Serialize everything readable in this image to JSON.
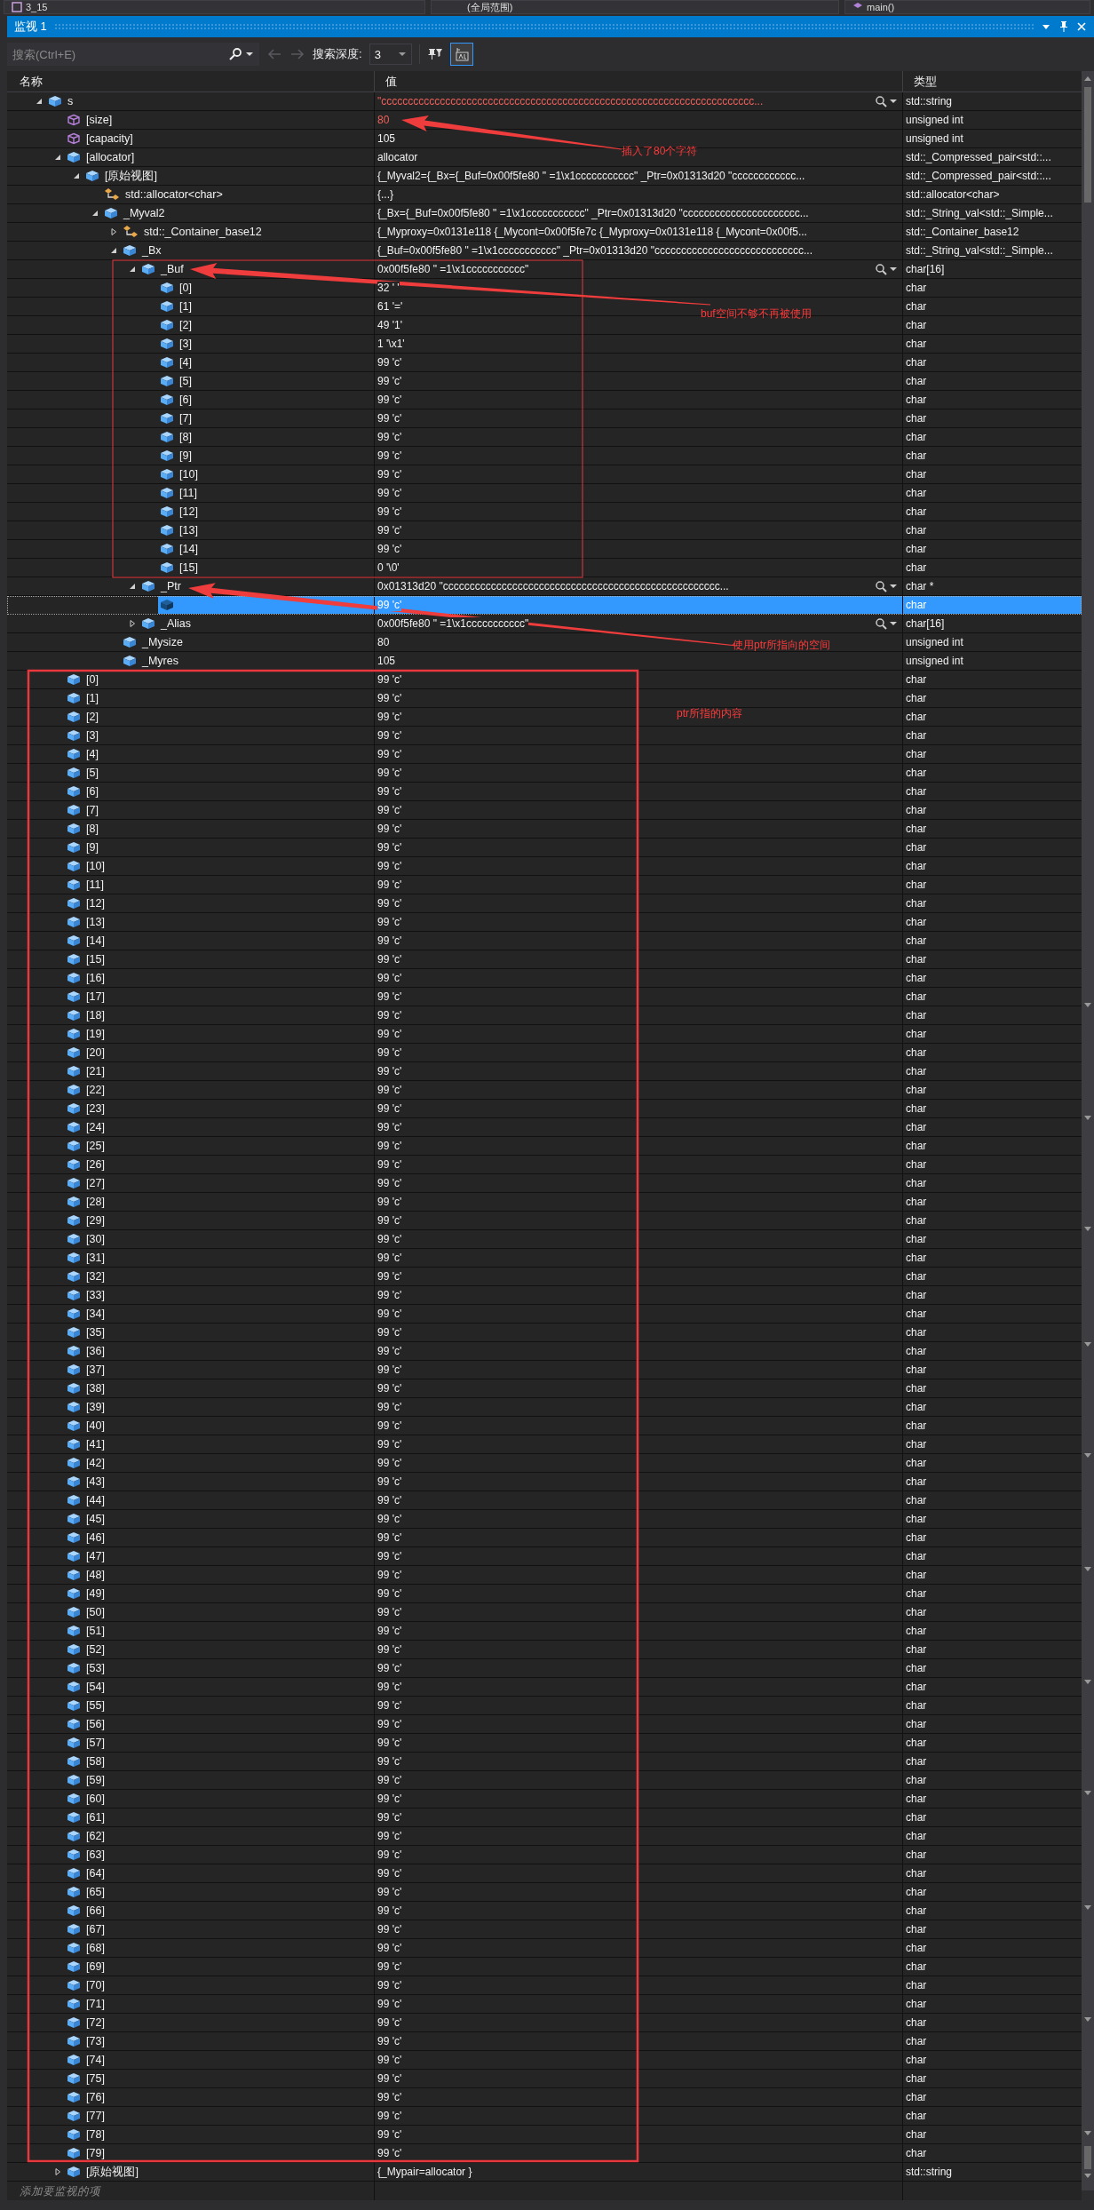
{
  "top_bar": {
    "project": "3_15",
    "scope": "(全局范围)",
    "function": "main()"
  },
  "window": {
    "title": "监视 1"
  },
  "search": {
    "placeholder": "搜索(Ctrl+E)",
    "history_disabled": true,
    "depth_label": "搜索深度:",
    "depth": "3",
    "view_toggle_selected": true
  },
  "columns": [
    "名称",
    "值",
    "类型"
  ],
  "rows": [
    {
      "name": "s",
      "value": "\"cccccccccccccccccccccccccccccccccccccccccccccccccccccccccccccccccccccc...",
      "type": "std::string",
      "kind": "field",
      "expanded": true,
      "changed": true,
      "visualizer": true,
      "selected": false,
      "children": [
        {
          "name": "[size]",
          "value": "80",
          "type": "unsigned int",
          "kind": "property",
          "changed": true,
          "selected": false
        },
        {
          "name": "[capacity]",
          "value": "105",
          "type": "unsigned int",
          "kind": "property",
          "changed": false,
          "selected": false
        },
        {
          "name": "[allocator]",
          "value": "allocator",
          "type": "std::_Compressed_pair<std::...",
          "kind": "field",
          "expanded": true,
          "changed": false,
          "selected": false,
          "children": [
            {
              "name": "[原始视图]",
              "value": "{_Myval2={_Bx={_Buf=0x00f5fe80 \" =1\\x1ccccccccccc\" _Ptr=0x01313d20 \"cccccccccccc...",
              "type": "std::_Compressed_pair<std::...",
              "kind": "field",
              "expanded": true,
              "changed": false,
              "selected": false,
              "children": [
                {
                  "name": "std::allocator<char>",
                  "value": "{...}",
                  "type": "std::allocator<char>",
                  "kind": "base",
                  "changed": false,
                  "selected": false
                },
                {
                  "name": "_Myval2",
                  "value": "{_Bx={_Buf=0x00f5fe80 \" =1\\x1ccccccccccc\" _Ptr=0x01313d20 \"cccccccccccccccccccccc...",
                  "type": "std::_String_val<std::_Simple...",
                  "kind": "field",
                  "expanded": true,
                  "changed": false,
                  "selected": false,
                  "children": [
                    {
                      "name": "std::_Container_base12",
                      "value": "{_Myproxy=0x0131e118 {_Mycont=0x00f5fe7c {_Myproxy=0x0131e118 {_Mycont=0x00f5...",
                      "type": "std::_Container_base12",
                      "kind": "base",
                      "expanded": false,
                      "changed": false,
                      "selected": false
                    },
                    {
                      "name": "_Bx",
                      "value": "{_Buf=0x00f5fe80 \" =1\\x1ccccccccccc\" _Ptr=0x01313d20 \"cccccccccccccccccccccccccccc...",
                      "type": "std::_String_val<std::_Simple...",
                      "kind": "field",
                      "expanded": true,
                      "changed": false,
                      "selected": false,
                      "children": [
                        {
                          "name": "_Buf",
                          "value": "0x00f5fe80 \" =1\\x1ccccccccccc\"",
                          "type": "char[16]",
                          "kind": "field",
                          "expanded": true,
                          "changed": false,
                          "visualizer": true,
                          "selected": false,
                          "children": [
                            {
                              "name": "[0]",
                              "value": "32 ' '",
                              "type": "char",
                              "kind": "field",
                              "changed": false,
                              "selected": false
                            },
                            {
                              "name": "[1]",
                              "value": "61 '='",
                              "type": "char",
                              "kind": "field",
                              "changed": false,
                              "selected": false
                            },
                            {
                              "name": "[2]",
                              "value": "49 '1'",
                              "type": "char",
                              "kind": "field",
                              "changed": false,
                              "selected": false
                            },
                            {
                              "name": "[3]",
                              "value": "1 '\\x1'",
                              "type": "char",
                              "kind": "field",
                              "changed": false,
                              "selected": false
                            },
                            {
                              "name": "[4]",
                              "value": "99 'c'",
                              "type": "char",
                              "kind": "field",
                              "changed": false,
                              "selected": false
                            },
                            {
                              "name": "[5]",
                              "value": "99 'c'",
                              "type": "char",
                              "kind": "field",
                              "changed": false,
                              "selected": false
                            },
                            {
                              "name": "[6]",
                              "value": "99 'c'",
                              "type": "char",
                              "kind": "field",
                              "changed": false,
                              "selected": false
                            },
                            {
                              "name": "[7]",
                              "value": "99 'c'",
                              "type": "char",
                              "kind": "field",
                              "changed": false,
                              "selected": false
                            },
                            {
                              "name": "[8]",
                              "value": "99 'c'",
                              "type": "char",
                              "kind": "field",
                              "changed": false,
                              "selected": false
                            },
                            {
                              "name": "[9]",
                              "value": "99 'c'",
                              "type": "char",
                              "kind": "field",
                              "changed": false,
                              "selected": false
                            },
                            {
                              "name": "[10]",
                              "value": "99 'c'",
                              "type": "char",
                              "kind": "field",
                              "changed": false,
                              "selected": false
                            },
                            {
                              "name": "[11]",
                              "value": "99 'c'",
                              "type": "char",
                              "kind": "field",
                              "changed": false,
                              "selected": false
                            },
                            {
                              "name": "[12]",
                              "value": "99 'c'",
                              "type": "char",
                              "kind": "field",
                              "changed": false,
                              "selected": false
                            },
                            {
                              "name": "[13]",
                              "value": "99 'c'",
                              "type": "char",
                              "kind": "field",
                              "changed": false,
                              "selected": false
                            },
                            {
                              "name": "[14]",
                              "value": "99 'c'",
                              "type": "char",
                              "kind": "field",
                              "changed": false,
                              "selected": false
                            },
                            {
                              "name": "[15]",
                              "value": "0 '\\0'",
                              "type": "char",
                              "kind": "field",
                              "changed": false,
                              "selected": false
                            }
                          ]
                        },
                        {
                          "name": "_Ptr",
                          "value": "0x01313d20 \"cccccccccccccccccccccccccccccccccccccccccccccccccccc...",
                          "type": "char *",
                          "kind": "field",
                          "expanded": true,
                          "changed": false,
                          "visualizer": true,
                          "selected": false,
                          "children": [
                            {
                              "value": "99 'c'",
                              "type": "char",
                              "kind": "field",
                              "changed": false,
                              "selected": true
                            }
                          ]
                        },
                        {
                          "name": "_Alias",
                          "value": "0x00f5fe80 \" =1\\x1ccccccccccc\"",
                          "type": "char[16]",
                          "kind": "field",
                          "expanded": false,
                          "changed": false,
                          "visualizer": true,
                          "selected": false
                        }
                      ]
                    },
                    {
                      "name": "_Mysize",
                      "value": "80",
                      "type": "unsigned int",
                      "kind": "field",
                      "changed": false,
                      "selected": false
                    },
                    {
                      "name": "_Myres",
                      "value": "105",
                      "type": "unsigned int",
                      "kind": "field",
                      "changed": false,
                      "selected": false
                    }
                  ]
                }
              ]
            }
          ]
        },
        {
          "name": "[0]",
          "value": "99 'c'",
          "type": "char",
          "kind": "field",
          "changed": false,
          "selected": false
        },
        {
          "name": "[1]",
          "value": "99 'c'",
          "type": "char",
          "kind": "field",
          "changed": false,
          "selected": false
        },
        {
          "name": "[2]",
          "value": "99 'c'",
          "type": "char",
          "kind": "field",
          "changed": false,
          "selected": false
        },
        {
          "name": "[3]",
          "value": "99 'c'",
          "type": "char",
          "kind": "field",
          "changed": false,
          "selected": false
        },
        {
          "name": "[4]",
          "value": "99 'c'",
          "type": "char",
          "kind": "field",
          "changed": false,
          "selected": false
        },
        {
          "name": "[5]",
          "value": "99 'c'",
          "type": "char",
          "kind": "field",
          "changed": false,
          "selected": false
        },
        {
          "name": "[6]",
          "value": "99 'c'",
          "type": "char",
          "kind": "field",
          "changed": false,
          "selected": false
        },
        {
          "name": "[7]",
          "value": "99 'c'",
          "type": "char",
          "kind": "field",
          "changed": false,
          "selected": false
        },
        {
          "name": "[8]",
          "value": "99 'c'",
          "type": "char",
          "kind": "field",
          "changed": false,
          "selected": false
        },
        {
          "name": "[9]",
          "value": "99 'c'",
          "type": "char",
          "kind": "field",
          "changed": false,
          "selected": false
        },
        {
          "name": "[10]",
          "value": "99 'c'",
          "type": "char",
          "kind": "field",
          "changed": false,
          "selected": false
        },
        {
          "name": "[11]",
          "value": "99 'c'",
          "type": "char",
          "kind": "field",
          "changed": false,
          "selected": false
        },
        {
          "name": "[12]",
          "value": "99 'c'",
          "type": "char",
          "kind": "field",
          "changed": false,
          "selected": false
        },
        {
          "name": "[13]",
          "value": "99 'c'",
          "type": "char",
          "kind": "field",
          "changed": false,
          "selected": false
        },
        {
          "name": "[14]",
          "value": "99 'c'",
          "type": "char",
          "kind": "field",
          "changed": false,
          "selected": false
        },
        {
          "name": "[15]",
          "value": "99 'c'",
          "type": "char",
          "kind": "field",
          "changed": false,
          "selected": false
        },
        {
          "name": "[16]",
          "value": "99 'c'",
          "type": "char",
          "kind": "field",
          "changed": false,
          "selected": false
        },
        {
          "name": "[17]",
          "value": "99 'c'",
          "type": "char",
          "kind": "field",
          "changed": false,
          "selected": false
        },
        {
          "name": "[18]",
          "value": "99 'c'",
          "type": "char",
          "kind": "field",
          "changed": false,
          "selected": false
        },
        {
          "name": "[19]",
          "value": "99 'c'",
          "type": "char",
          "kind": "field",
          "changed": false,
          "selected": false
        },
        {
          "name": "[20]",
          "value": "99 'c'",
          "type": "char",
          "kind": "field",
          "changed": false,
          "selected": false
        },
        {
          "name": "[21]",
          "value": "99 'c'",
          "type": "char",
          "kind": "field",
          "changed": false,
          "selected": false
        },
        {
          "name": "[22]",
          "value": "99 'c'",
          "type": "char",
          "kind": "field",
          "changed": false,
          "selected": false
        },
        {
          "name": "[23]",
          "value": "99 'c'",
          "type": "char",
          "kind": "field",
          "changed": false,
          "selected": false
        },
        {
          "name": "[24]",
          "value": "99 'c'",
          "type": "char",
          "kind": "field",
          "changed": false,
          "selected": false
        },
        {
          "name": "[25]",
          "value": "99 'c'",
          "type": "char",
          "kind": "field",
          "changed": false,
          "selected": false
        },
        {
          "name": "[26]",
          "value": "99 'c'",
          "type": "char",
          "kind": "field",
          "changed": false,
          "selected": false
        },
        {
          "name": "[27]",
          "value": "99 'c'",
          "type": "char",
          "kind": "field",
          "changed": false,
          "selected": false
        },
        {
          "name": "[28]",
          "value": "99 'c'",
          "type": "char",
          "kind": "field",
          "changed": false,
          "selected": false
        },
        {
          "name": "[29]",
          "value": "99 'c'",
          "type": "char",
          "kind": "field",
          "changed": false,
          "selected": false
        },
        {
          "name": "[30]",
          "value": "99 'c'",
          "type": "char",
          "kind": "field",
          "changed": false,
          "selected": false
        },
        {
          "name": "[31]",
          "value": "99 'c'",
          "type": "char",
          "kind": "field",
          "changed": false,
          "selected": false
        },
        {
          "name": "[32]",
          "value": "99 'c'",
          "type": "char",
          "kind": "field",
          "changed": false,
          "selected": false
        },
        {
          "name": "[33]",
          "value": "99 'c'",
          "type": "char",
          "kind": "field",
          "changed": false,
          "selected": false
        },
        {
          "name": "[34]",
          "value": "99 'c'",
          "type": "char",
          "kind": "field",
          "changed": false,
          "selected": false
        },
        {
          "name": "[35]",
          "value": "99 'c'",
          "type": "char",
          "kind": "field",
          "changed": false,
          "selected": false
        },
        {
          "name": "[36]",
          "value": "99 'c'",
          "type": "char",
          "kind": "field",
          "changed": false,
          "selected": false
        },
        {
          "name": "[37]",
          "value": "99 'c'",
          "type": "char",
          "kind": "field",
          "changed": false,
          "selected": false
        },
        {
          "name": "[38]",
          "value": "99 'c'",
          "type": "char",
          "kind": "field",
          "changed": false,
          "selected": false
        },
        {
          "name": "[39]",
          "value": "99 'c'",
          "type": "char",
          "kind": "field",
          "changed": false,
          "selected": false
        },
        {
          "name": "[40]",
          "value": "99 'c'",
          "type": "char",
          "kind": "field",
          "changed": false,
          "selected": false
        },
        {
          "name": "[41]",
          "value": "99 'c'",
          "type": "char",
          "kind": "field",
          "changed": false,
          "selected": false
        },
        {
          "name": "[42]",
          "value": "99 'c'",
          "type": "char",
          "kind": "field",
          "changed": false,
          "selected": false
        },
        {
          "name": "[43]",
          "value": "99 'c'",
          "type": "char",
          "kind": "field",
          "changed": false,
          "selected": false
        },
        {
          "name": "[44]",
          "value": "99 'c'",
          "type": "char",
          "kind": "field",
          "changed": false,
          "selected": false
        },
        {
          "name": "[45]",
          "value": "99 'c'",
          "type": "char",
          "kind": "field",
          "changed": false,
          "selected": false
        },
        {
          "name": "[46]",
          "value": "99 'c'",
          "type": "char",
          "kind": "field",
          "changed": false,
          "selected": false
        },
        {
          "name": "[47]",
          "value": "99 'c'",
          "type": "char",
          "kind": "field",
          "changed": false,
          "selected": false
        },
        {
          "name": "[48]",
          "value": "99 'c'",
          "type": "char",
          "kind": "field",
          "changed": false,
          "selected": false
        },
        {
          "name": "[49]",
          "value": "99 'c'",
          "type": "char",
          "kind": "field",
          "changed": false,
          "selected": false
        },
        {
          "name": "[50]",
          "value": "99 'c'",
          "type": "char",
          "kind": "field",
          "changed": false,
          "selected": false
        },
        {
          "name": "[51]",
          "value": "99 'c'",
          "type": "char",
          "kind": "field",
          "changed": false,
          "selected": false
        },
        {
          "name": "[52]",
          "value": "99 'c'",
          "type": "char",
          "kind": "field",
          "changed": false,
          "selected": false
        },
        {
          "name": "[53]",
          "value": "99 'c'",
          "type": "char",
          "kind": "field",
          "changed": false,
          "selected": false
        },
        {
          "name": "[54]",
          "value": "99 'c'",
          "type": "char",
          "kind": "field",
          "changed": false,
          "selected": false
        },
        {
          "name": "[55]",
          "value": "99 'c'",
          "type": "char",
          "kind": "field",
          "changed": false,
          "selected": false
        },
        {
          "name": "[56]",
          "value": "99 'c'",
          "type": "char",
          "kind": "field",
          "changed": false,
          "selected": false
        },
        {
          "name": "[57]",
          "value": "99 'c'",
          "type": "char",
          "kind": "field",
          "changed": false,
          "selected": false
        },
        {
          "name": "[58]",
          "value": "99 'c'",
          "type": "char",
          "kind": "field",
          "changed": false,
          "selected": false
        },
        {
          "name": "[59]",
          "value": "99 'c'",
          "type": "char",
          "kind": "field",
          "changed": false,
          "selected": false
        },
        {
          "name": "[60]",
          "value": "99 'c'",
          "type": "char",
          "kind": "field",
          "changed": false,
          "selected": false
        },
        {
          "name": "[61]",
          "value": "99 'c'",
          "type": "char",
          "kind": "field",
          "changed": false,
          "selected": false
        },
        {
          "name": "[62]",
          "value": "99 'c'",
          "type": "char",
          "kind": "field",
          "changed": false,
          "selected": false
        },
        {
          "name": "[63]",
          "value": "99 'c'",
          "type": "char",
          "kind": "field",
          "changed": false,
          "selected": false
        },
        {
          "name": "[64]",
          "value": "99 'c'",
          "type": "char",
          "kind": "field",
          "changed": false,
          "selected": false
        },
        {
          "name": "[65]",
          "value": "99 'c'",
          "type": "char",
          "kind": "field",
          "changed": false,
          "selected": false
        },
        {
          "name": "[66]",
          "value": "99 'c'",
          "type": "char",
          "kind": "field",
          "changed": false,
          "selected": false
        },
        {
          "name": "[67]",
          "value": "99 'c'",
          "type": "char",
          "kind": "field",
          "changed": false,
          "selected": false
        },
        {
          "name": "[68]",
          "value": "99 'c'",
          "type": "char",
          "kind": "field",
          "changed": false,
          "selected": false
        },
        {
          "name": "[69]",
          "value": "99 'c'",
          "type": "char",
          "kind": "field",
          "changed": false,
          "selected": false
        },
        {
          "name": "[70]",
          "value": "99 'c'",
          "type": "char",
          "kind": "field",
          "changed": false,
          "selected": false
        },
        {
          "name": "[71]",
          "value": "99 'c'",
          "type": "char",
          "kind": "field",
          "changed": false,
          "selected": false
        },
        {
          "name": "[72]",
          "value": "99 'c'",
          "type": "char",
          "kind": "field",
          "changed": false,
          "selected": false
        },
        {
          "name": "[73]",
          "value": "99 'c'",
          "type": "char",
          "kind": "field",
          "changed": false,
          "selected": false
        },
        {
          "name": "[74]",
          "value": "99 'c'",
          "type": "char",
          "kind": "field",
          "changed": false,
          "selected": false
        },
        {
          "name": "[75]",
          "value": "99 'c'",
          "type": "char",
          "kind": "field",
          "changed": false,
          "selected": false
        },
        {
          "name": "[76]",
          "value": "99 'c'",
          "type": "char",
          "kind": "field",
          "changed": false,
          "selected": false
        },
        {
          "name": "[77]",
          "value": "99 'c'",
          "type": "char",
          "kind": "field",
          "changed": false,
          "selected": false
        },
        {
          "name": "[78]",
          "value": "99 'c'",
          "type": "char",
          "kind": "field",
          "changed": false,
          "selected": false
        },
        {
          "name": "[79]",
          "value": "99 'c'",
          "type": "char",
          "kind": "field",
          "changed": false,
          "selected": false
        },
        {
          "name": "[原始视图]",
          "value": "{_Mypair=allocator }",
          "type": "std::string",
          "kind": "field",
          "expanded": false,
          "changed": false,
          "selected": false
        }
      ]
    }
  ],
  "add_row": {
    "placeholder": "添加要监视的项"
  },
  "annotations": [
    {
      "text": "插入了80个字符"
    },
    {
      "text": "buf空间不够不再被使用"
    },
    {
      "text": "使用ptr所指向的空间"
    },
    {
      "text": "ptr所指的内容"
    }
  ]
}
